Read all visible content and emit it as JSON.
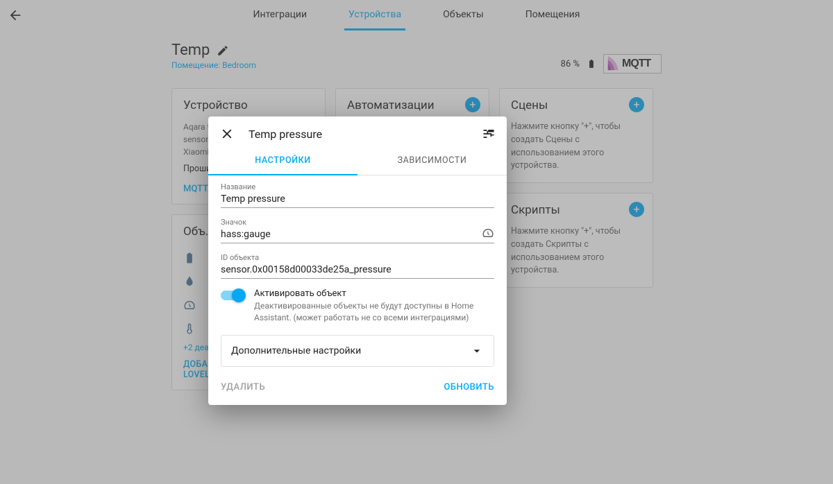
{
  "nav": {
    "tabs": {
      "integrations": "Интеграции",
      "devices": "Устройства",
      "entities": "Объекты",
      "areas": "Помещения"
    }
  },
  "device": {
    "name": "Temp",
    "area_label": "Помещение: Bedroom",
    "battery_pct": "86 %",
    "logo_text": "MQTT"
  },
  "cards": {
    "device": {
      "title": "Устройство",
      "line1": "Aqara t…",
      "line2": "sensor …",
      "line3": "Xiaomi",
      "firmware": "Проши…",
      "mqtt_info": "MQTT…"
    },
    "automations": {
      "title": "Автоматизации"
    },
    "scenes": {
      "title": "Сцены",
      "help": "Нажмите кнопку \"+\", чтобы создать Сцены с использованием этого устройства."
    },
    "scripts": {
      "title": "Скрипты",
      "help": "Нажмите кнопку \"+\", чтобы создать Скрипты с использованием этого устройства."
    },
    "entities": {
      "title": "Объ…",
      "more": "+2 деак…",
      "lovelace": "ДОБАВИТЬ ОБЪЕКТЫ В LOVELACE UI"
    }
  },
  "dialog": {
    "title": "Temp pressure",
    "tabs": {
      "settings": "Настройки",
      "related": "Зависимости"
    },
    "fields": {
      "name_label": "Название",
      "name_value": "Temp pressure",
      "icon_label": "Значок",
      "icon_value": "hass:gauge",
      "entity_label": "ID объекта",
      "entity_value": "sensor.0x00158d00033de25a_pressure"
    },
    "toggle": {
      "title": "Активировать объект",
      "sub": "Деактивированные объекты не будут доступны в Home Assistant. (может работать не со всеми интеграциями)"
    },
    "advanced": "Дополнительные настройки",
    "delete": "УДАЛИТЬ",
    "update": "ОБНОВИТЬ"
  }
}
